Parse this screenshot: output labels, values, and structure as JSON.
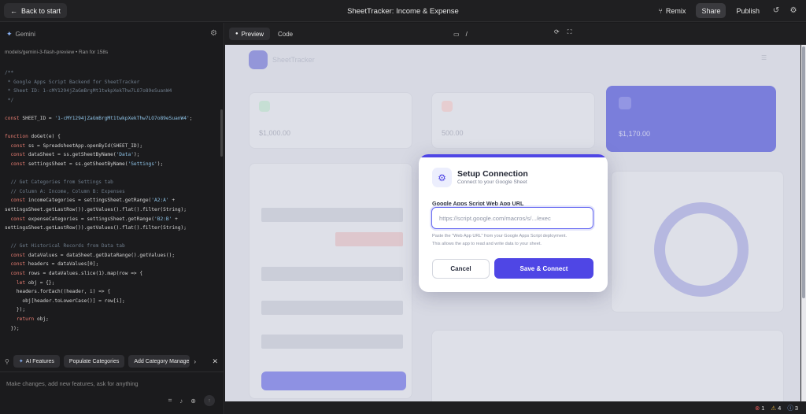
{
  "topbar": {
    "back_label": "Back to start",
    "title": "SheetTracker: Income & Expense",
    "remix_label": "Remix",
    "share_label": "Share",
    "publish_label": "Publish"
  },
  "left": {
    "model_label": "Gemini",
    "meta": "models/gemini-3-flash-preview  •  Ran for 158s",
    "code_lines": [
      "/**",
      " * Google Apps Script Backend for SheetTracker",
      " * Sheet ID: 1-cMY1294jZaGmBrgMt1twkpXekThw7LO7o89eSuanW4",
      " */",
      "",
      "const SHEET_ID = '1-cMY1294jZaGmBrgMt1twkpXekThw7LO7o89eSuanW4';",
      "",
      "function doGet(e) {",
      "  const ss = SpreadsheetApp.openById(SHEET_ID);",
      "  const dataSheet = ss.getSheetByName('Data');",
      "  const settingsSheet = ss.getSheetByName('Settings');",
      "",
      "  // Get Categories from Settings tab",
      "  // Column A: Income, Column B: Expenses",
      "  const incomeCategories = settingsSheet.getRange('A2:A' +",
      "settingsSheet.getLastRow()).getValues().flat().filter(String);",
      "  const expenseCategories = settingsSheet.getRange('B2:B' +",
      "settingsSheet.getLastRow()).getValues().flat().filter(String);",
      "",
      "  // Get Historical Records from Data tab",
      "  const dataValues = dataSheet.getDataRange().getValues();",
      "  const headers = dataValues[0];",
      "  const rows = dataValues.slice(1).map(row => {",
      "    let obj = {};",
      "    headers.forEach((header, i) => {",
      "      obj[header.toLowerCase()] = row[i];",
      "    });",
      "    return obj;",
      "  });"
    ],
    "chips": [
      "AI Features",
      "Populate Categories",
      "Add Category Manage"
    ],
    "prompt_placeholder": "Make changes, add new features, ask for anything"
  },
  "preview_toolbar": {
    "tab_preview": "Preview",
    "tab_code": "Code",
    "url_path": "/"
  },
  "preview_app": {
    "brand": "SheetTracker",
    "card1_value": "$1,000.00",
    "card2_value": "500.00",
    "card3_value": "$1,170.00"
  },
  "modal": {
    "title": "Setup Connection",
    "subtitle": "Connect to your Google Sheet",
    "field_label": "Google Apps Script Web App URL",
    "field_placeholder": "https://script.google.com/macros/s/.../exec",
    "help_line1": "Paste the \"Web App URL\" from your Google Apps Script deployment.",
    "help_line2": "This allows the app to read and write data to your sheet.",
    "cancel_label": "Cancel",
    "save_label": "Save & Connect"
  },
  "status": {
    "errors": "1",
    "warnings": "4",
    "info": "3"
  },
  "colors": {
    "accent": "#4f46e5",
    "error": "#e05a5a",
    "warning": "#e0b040",
    "info": "#8ab4f8"
  }
}
